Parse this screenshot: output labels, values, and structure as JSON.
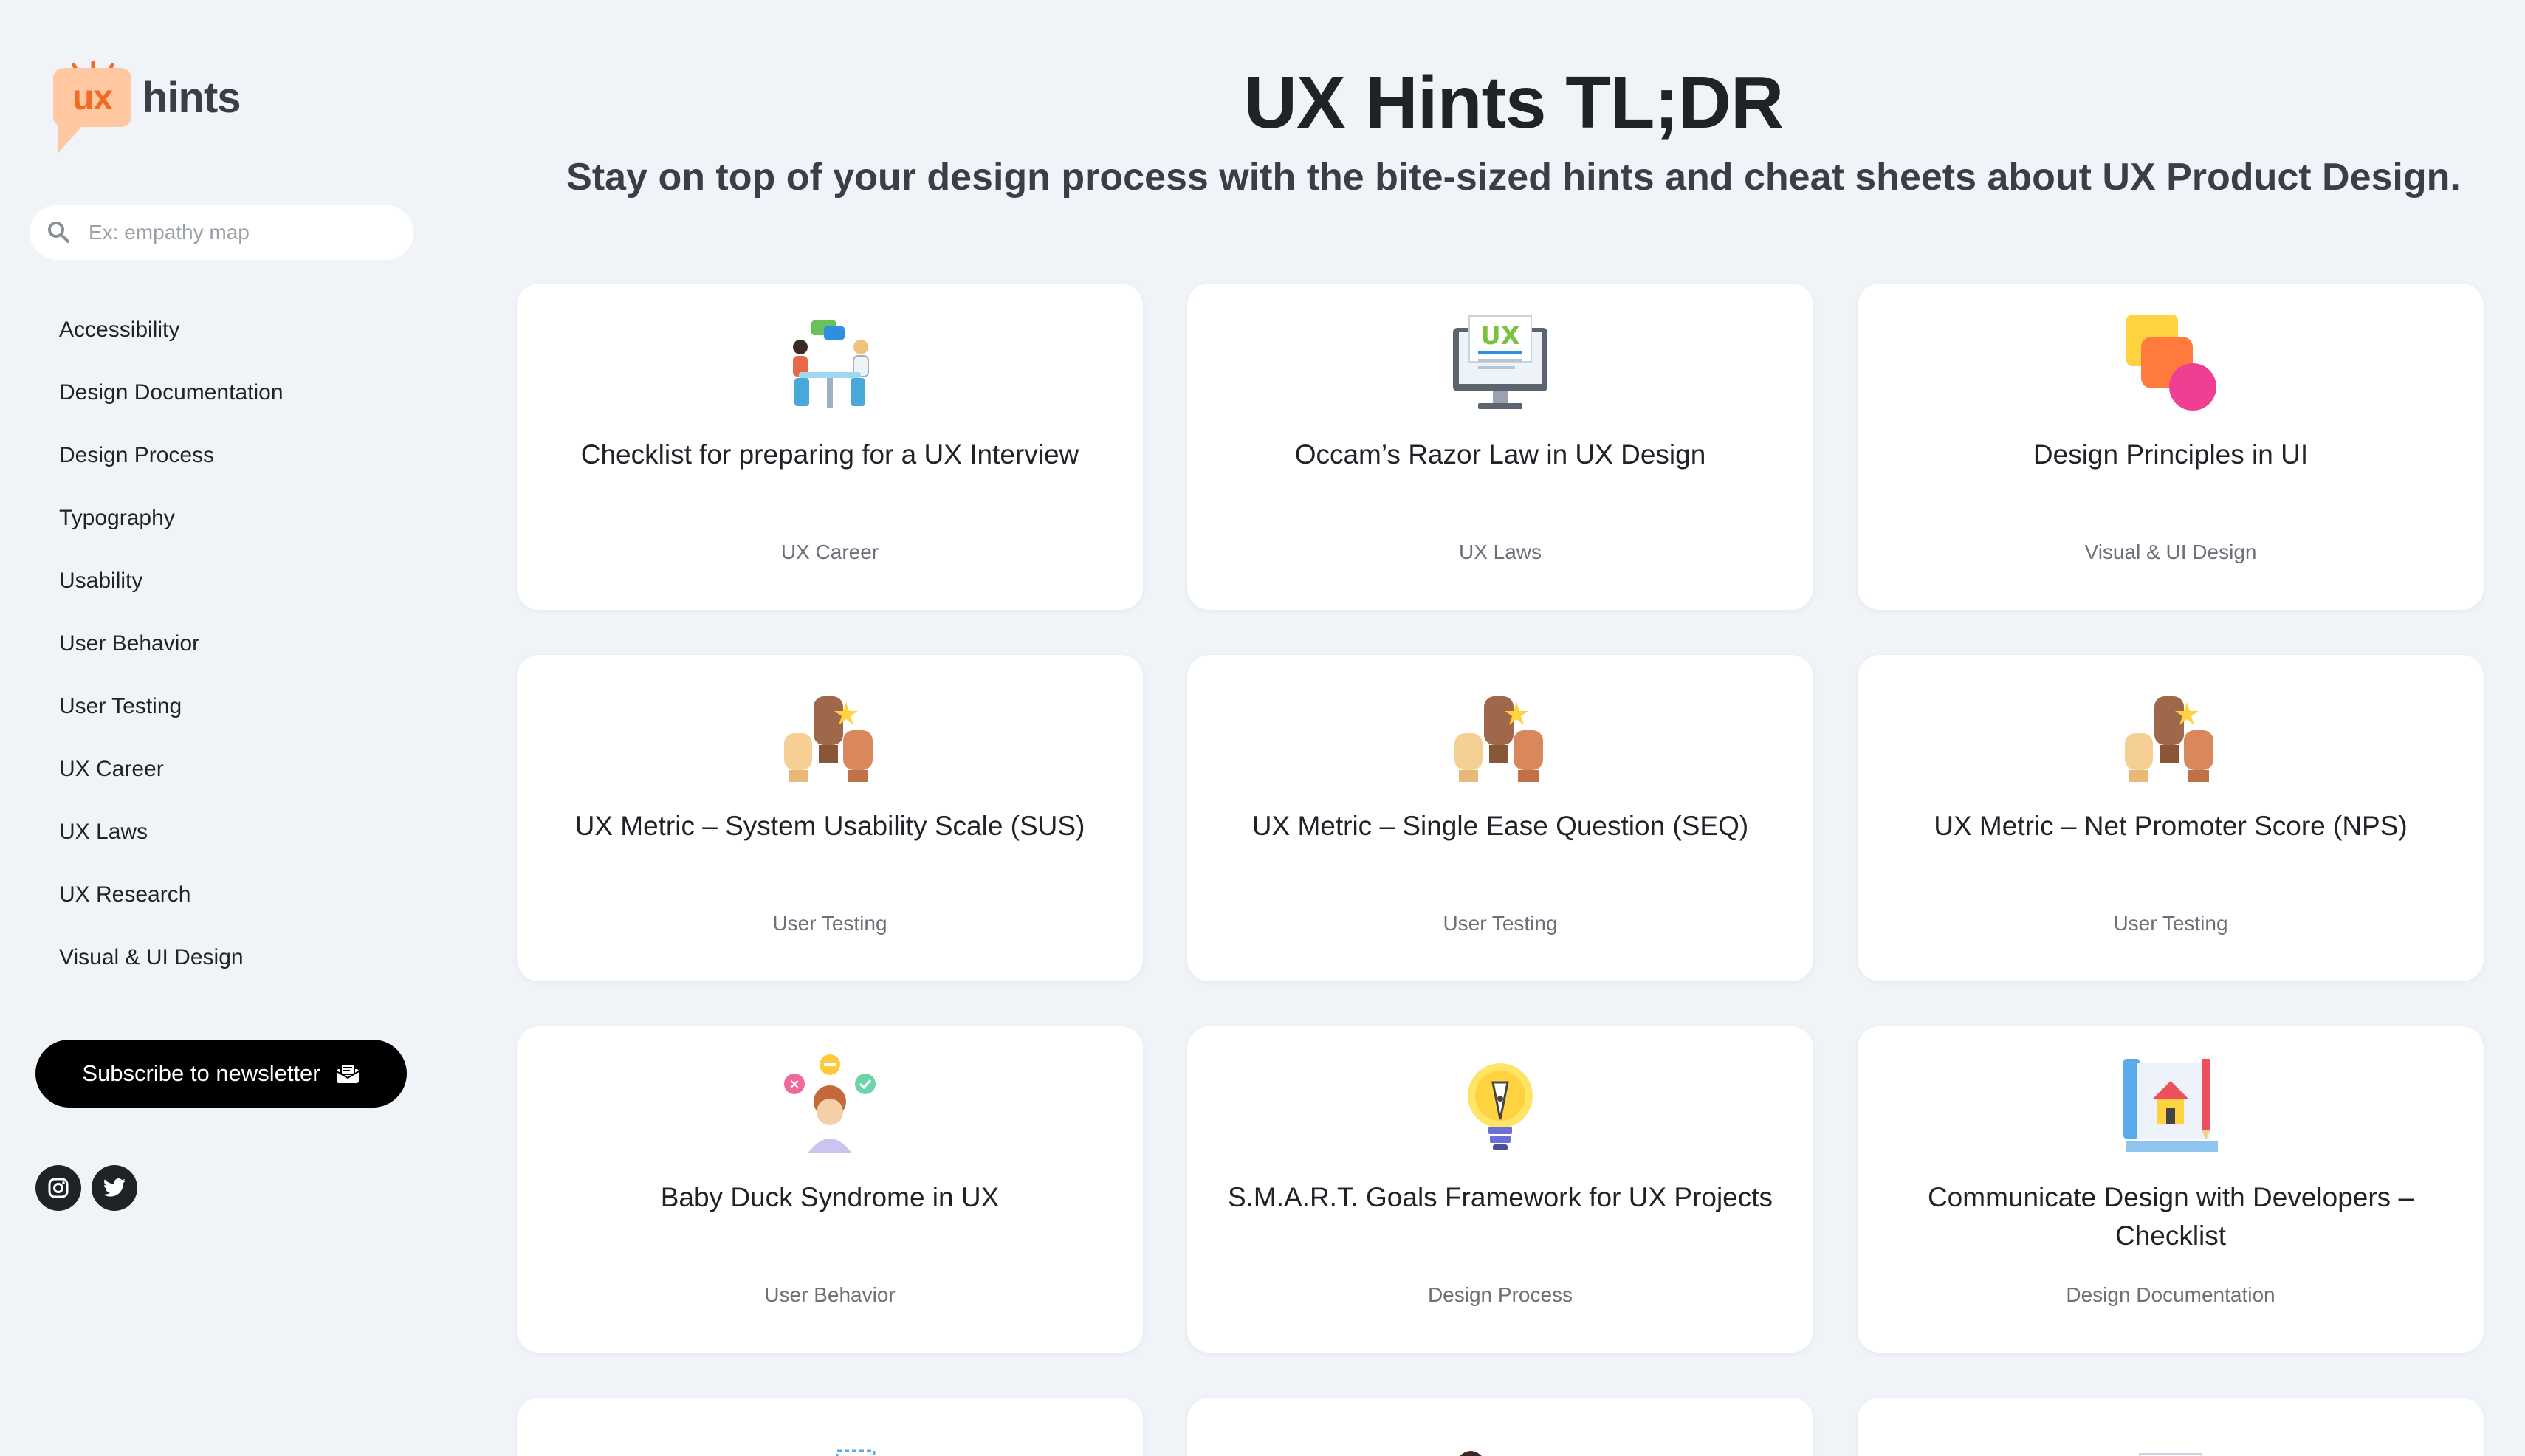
{
  "logo": {
    "badge": "ux",
    "text": "hints"
  },
  "search": {
    "placeholder": "Ex: empathy map"
  },
  "nav": [
    "Accessibility",
    "Design Documentation",
    "Design Process",
    "Typography",
    "Usability",
    "User Behavior",
    "User Testing",
    "UX Career",
    "UX Laws",
    "UX Research",
    "Visual & UI Design"
  ],
  "subscribe_label": "Subscribe to newsletter",
  "social": [
    "instagram-icon",
    "twitter-icon"
  ],
  "header": {
    "title": "UX Hints TL;DR",
    "subtitle": "Stay on top of your design process with the bite-sized hints and cheat sheets about UX Product Design."
  },
  "cards": [
    {
      "title": "Checklist for preparing for a UX Interview",
      "category": "UX Career",
      "icon": "interview-illustration"
    },
    {
      "title": "Occam’s Razor Law in UX Design",
      "category": "UX Laws",
      "icon": "ux-monitor-illustration"
    },
    {
      "title": "Design Principles in UI",
      "category": "Visual & UI Design",
      "icon": "shapes-illustration"
    },
    {
      "title": "UX Metric – System Usability Scale (SUS)",
      "category": "User Testing",
      "icon": "raised-hands-illustration"
    },
    {
      "title": "UX Metric – Single Ease Question (SEQ)",
      "category": "User Testing",
      "icon": "raised-hands-illustration"
    },
    {
      "title": "UX Metric – Net Promoter Score (NPS)",
      "category": "User Testing",
      "icon": "raised-hands-illustration"
    },
    {
      "title": "Baby Duck Syndrome in UX",
      "category": "User Behavior",
      "icon": "choice-person-illustration"
    },
    {
      "title": "S.M.A.R.T. Goals Framework for UX Projects",
      "category": "Design Process",
      "icon": "lightbulb-pen-illustration"
    },
    {
      "title": "Communicate Design with Developers – Checklist",
      "category": "Design Documentation",
      "icon": "blueprint-house-illustration"
    },
    {
      "title": "",
      "category": "",
      "icon": "cone-illustration"
    },
    {
      "title": "",
      "category": "",
      "icon": "person-device-illustration"
    },
    {
      "title": "",
      "category": "",
      "icon": "ux-monitor-illustration"
    }
  ],
  "colors": {
    "background": "#f0f4f8",
    "accent": "#f26a24",
    "logo_badge": "#ffc8a0",
    "button": "#000000"
  }
}
